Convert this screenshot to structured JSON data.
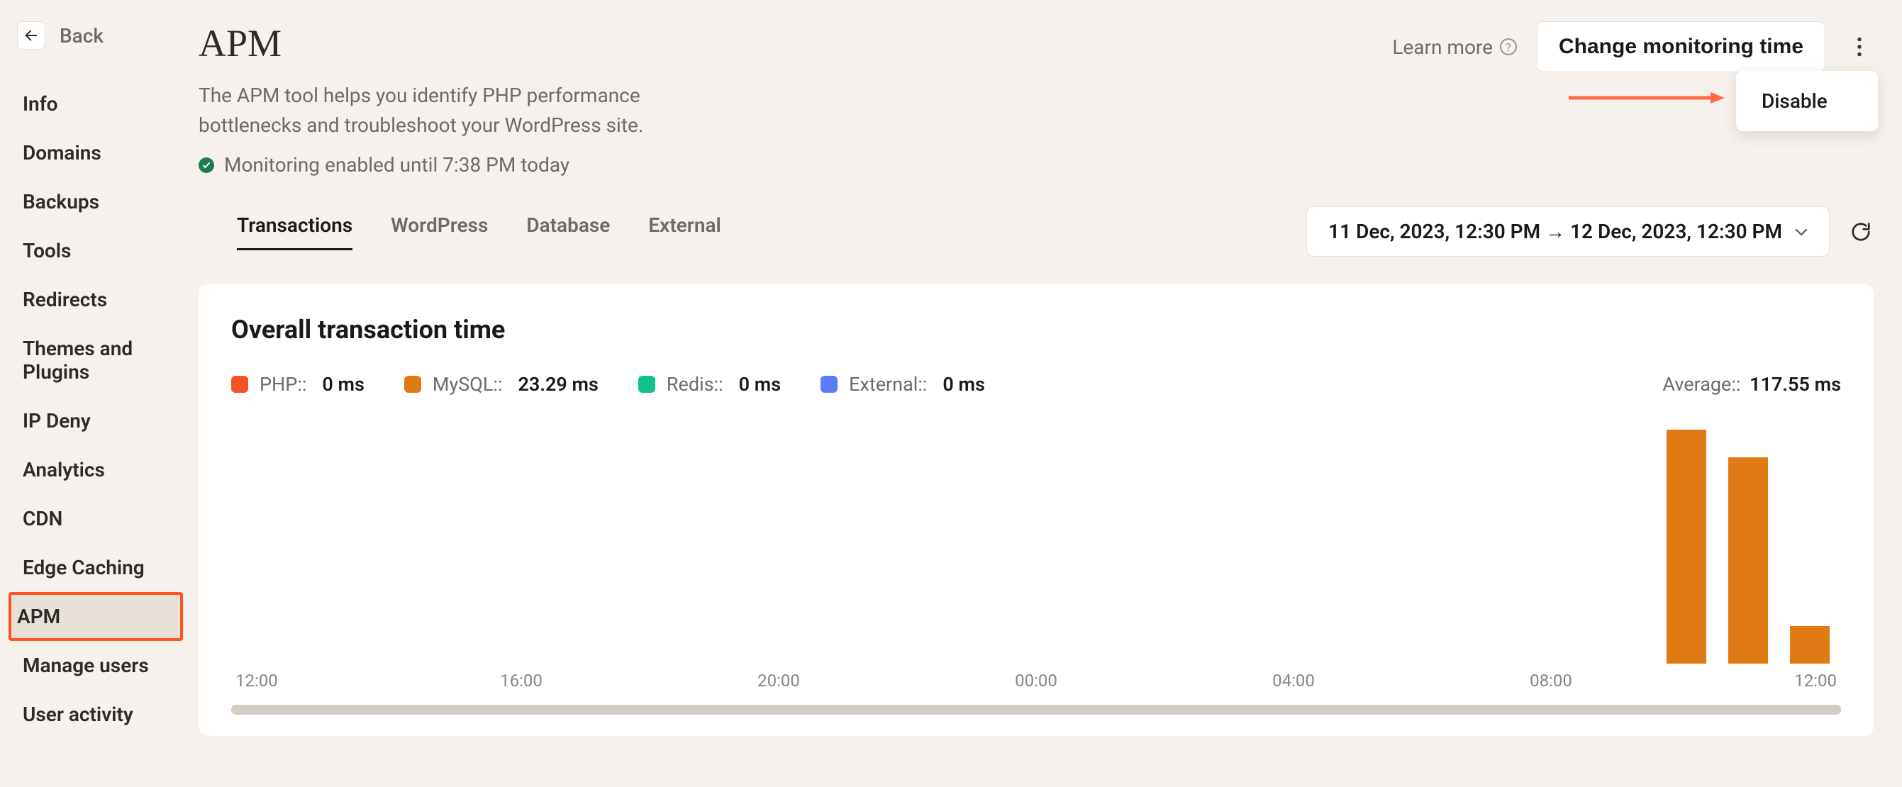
{
  "sidebar": {
    "back_label": "Back",
    "items": [
      {
        "label": "Info"
      },
      {
        "label": "Domains"
      },
      {
        "label": "Backups"
      },
      {
        "label": "Tools"
      },
      {
        "label": "Redirects"
      },
      {
        "label": "Themes and Plugins"
      },
      {
        "label": "IP Deny"
      },
      {
        "label": "Analytics"
      },
      {
        "label": "CDN"
      },
      {
        "label": "Edge Caching"
      },
      {
        "label": "APM"
      },
      {
        "label": "Manage users"
      },
      {
        "label": "User activity"
      }
    ],
    "active_index": 10
  },
  "header": {
    "title": "APM",
    "description": "The APM tool helps you identify PHP performance bottlenecks and troubleshoot your WordPress site.",
    "status_text": "Monitoring enabled until 7:38 PM today",
    "learn_more": "Learn more",
    "change_btn": "Change monitoring time",
    "menu_items": [
      {
        "label": "Disable"
      }
    ]
  },
  "tabs": {
    "items": [
      {
        "label": "Transactions"
      },
      {
        "label": "WordPress"
      },
      {
        "label": "Database"
      },
      {
        "label": "External"
      }
    ],
    "active_index": 0
  },
  "date_range": {
    "text": "11 Dec, 2023, 12:30 PM → 12 Dec, 2023, 12:30 PM"
  },
  "card": {
    "title": "Overall transaction time",
    "legend": [
      {
        "name": "PHP::",
        "value": "0 ms",
        "color": "#f35424"
      },
      {
        "name": "MySQL::",
        "value": "23.29 ms",
        "color": "#e07a14"
      },
      {
        "name": "Redis::",
        "value": "0 ms",
        "color": "#0fc28b"
      },
      {
        "name": "External::",
        "value": "0 ms",
        "color": "#5c7cfa"
      }
    ],
    "average": {
      "label": "Average::",
      "value": "117.55 ms"
    }
  },
  "chart_data": {
    "type": "bar",
    "categories": [
      "12:00",
      "16:00",
      "20:00",
      "00:00",
      "04:00",
      "08:00",
      "12:00"
    ],
    "series": [
      {
        "name": "MySQL",
        "color": "#e07a14",
        "values": [
          0,
          0,
          0,
          0,
          0,
          0,
          0,
          0,
          0,
          0,
          0,
          0,
          0,
          0,
          0,
          0,
          0,
          0,
          0,
          0,
          0,
          0,
          0,
          340,
          300,
          55
        ]
      }
    ],
    "title": "Overall transaction time",
    "xlabel": "",
    "ylabel": "",
    "ylim": [
      0,
      350
    ]
  }
}
